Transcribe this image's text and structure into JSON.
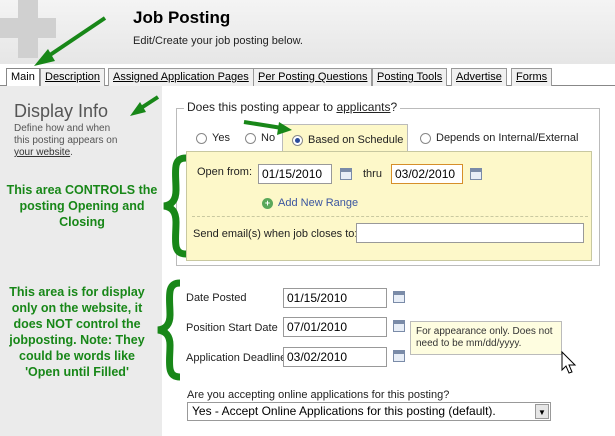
{
  "header": {
    "title": "Job Posting",
    "subtitle": "Edit/Create your job posting below."
  },
  "tabs": [
    "Main",
    "Description",
    "Assigned Application Pages",
    "Per Posting Questions",
    "Posting Tools",
    "Advertise",
    "Forms"
  ],
  "active_tab": "Main",
  "sidebar": {
    "heading": "Display Info",
    "desc_line1": "Define how and when",
    "desc_line2": "this posting appears on",
    "desc_link": "your website",
    "desc_end": "."
  },
  "callouts": {
    "controls": "This area CONTROLS the posting Opening and Closing",
    "display_only": "This area is for display only on the website, it does NOT control the jobposting. Note: They could be words like 'Open until Filled'"
  },
  "appear": {
    "question_prefix": "Does this posting appear to ",
    "question_link": "applicants",
    "question_suffix": "?",
    "options": [
      "Yes",
      "No",
      "Based on Schedule",
      "Depends on Internal/External"
    ],
    "selected": "Based on Schedule"
  },
  "schedule": {
    "open_from_label": "Open from:",
    "open_from_value": "01/15/2010",
    "thru_label": "thru",
    "thru_value": "03/02/2010",
    "add_range_label": "Add New Range",
    "email_label": "Send email(s) when job closes to:",
    "email_value": ""
  },
  "display_fields": {
    "date_posted_label": "Date Posted",
    "date_posted_value": "01/15/2010",
    "start_date_label": "Position Start Date",
    "start_date_value": "07/01/2010",
    "deadline_label": "Application Deadline",
    "deadline_value": "03/02/2010",
    "tooltip": "For appearance only. Does not need to be mm/dd/yyyy."
  },
  "online": {
    "question": "Are you accepting online applications for this posting?",
    "selected": "Yes - Accept Online Applications for this posting (default)."
  },
  "colors": {
    "annotation_green": "#188718",
    "schedule_yellow": "#fdf8c9"
  }
}
